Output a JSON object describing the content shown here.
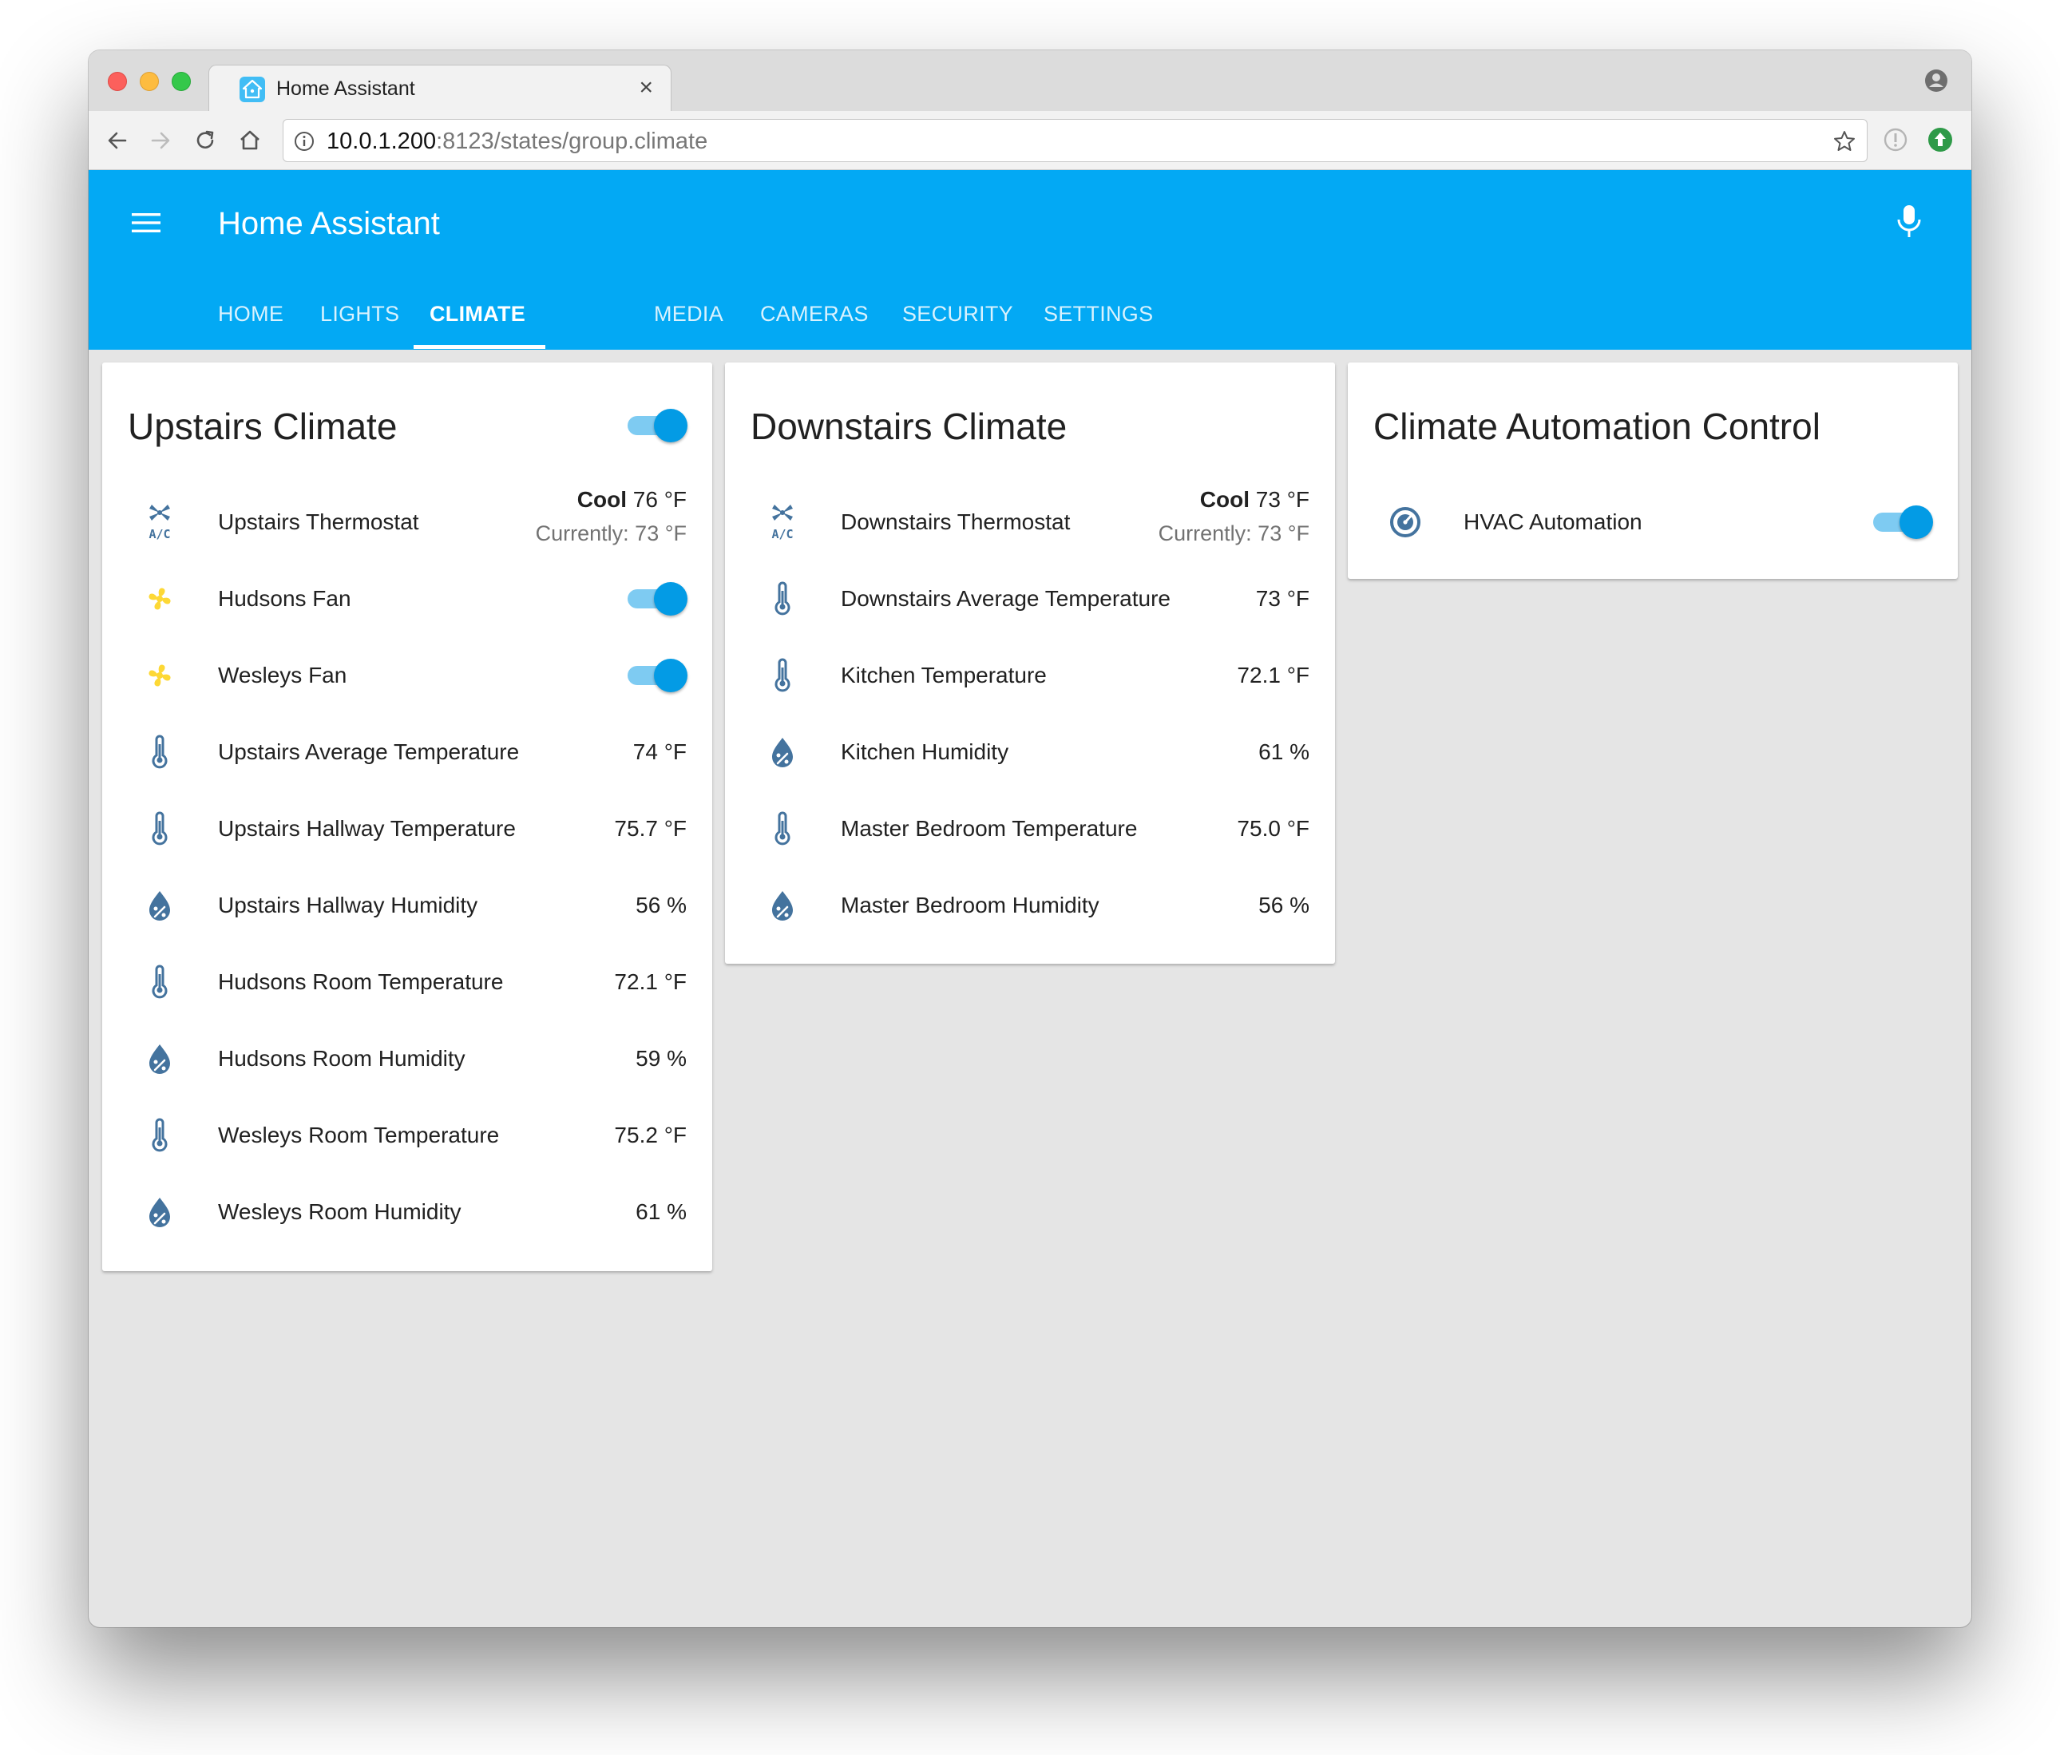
{
  "browser": {
    "tab_title": "Home Assistant",
    "tab_close": "×",
    "url_host": "10.0.1.200",
    "url_rest": ":8123/states/group.climate"
  },
  "app": {
    "title": "Home Assistant",
    "accent_color": "#03a9f4",
    "tabs": [
      {
        "label": "HOME"
      },
      {
        "label": "LIGHTS"
      },
      {
        "label": "CLIMATE",
        "active": true
      },
      {
        "label": "MEDIA"
      },
      {
        "label": "CAMERAS"
      },
      {
        "label": "SECURITY"
      },
      {
        "label": "SETTINGS"
      }
    ]
  },
  "cards": {
    "upstairs": {
      "title": "Upstairs Climate",
      "toggle_on": true,
      "thermostat": {
        "name": "Upstairs Thermostat",
        "mode": "Cool",
        "target": "76 °F",
        "current": "Currently: 73 °F",
        "icon": "air-conditioner-icon"
      },
      "fans": [
        {
          "name": "Hudsons Fan",
          "on": true,
          "icon": "fan-icon"
        },
        {
          "name": "Wesleys Fan",
          "on": true,
          "icon": "fan-icon"
        }
      ],
      "sensors": [
        {
          "name": "Upstairs Average Temperature",
          "value": "74 °F",
          "icon": "thermometer-icon"
        },
        {
          "name": "Upstairs Hallway Temperature",
          "value": "75.7 °F",
          "icon": "thermometer-icon"
        },
        {
          "name": "Upstairs Hallway Humidity",
          "value": "56 %",
          "icon": "water-percent-icon"
        },
        {
          "name": "Hudsons Room Temperature",
          "value": "72.1 °F",
          "icon": "thermometer-icon"
        },
        {
          "name": "Hudsons Room Humidity",
          "value": "59 %",
          "icon": "water-percent-icon"
        },
        {
          "name": "Wesleys Room Temperature",
          "value": "75.2 °F",
          "icon": "thermometer-icon"
        },
        {
          "name": "Wesleys Room Humidity",
          "value": "61 %",
          "icon": "water-percent-icon"
        }
      ]
    },
    "downstairs": {
      "title": "Downstairs Climate",
      "thermostat": {
        "name": "Downstairs Thermostat",
        "mode": "Cool",
        "target": "73 °F",
        "current": "Currently: 73 °F",
        "icon": "air-conditioner-icon"
      },
      "sensors": [
        {
          "name": "Downstairs Average Temperature",
          "value": "73 °F",
          "icon": "thermometer-icon"
        },
        {
          "name": "Kitchen Temperature",
          "value": "72.1 °F",
          "icon": "thermometer-icon"
        },
        {
          "name": "Kitchen Humidity",
          "value": "61 %",
          "icon": "water-percent-icon"
        },
        {
          "name": "Master Bedroom Temperature",
          "value": "75.0 °F",
          "icon": "thermometer-icon"
        },
        {
          "name": "Master Bedroom Humidity",
          "value": "56 %",
          "icon": "water-percent-icon"
        }
      ]
    },
    "automation": {
      "title": "Climate Automation Control",
      "items": [
        {
          "name": "HVAC Automation",
          "on": true,
          "icon": "robot-icon"
        }
      ]
    }
  },
  "colors": {
    "icon_blue": "#44739e",
    "fan_yellow": "#fdd835",
    "toggle_thumb": "#039be5",
    "toggle_track": "#7ecbf2"
  }
}
